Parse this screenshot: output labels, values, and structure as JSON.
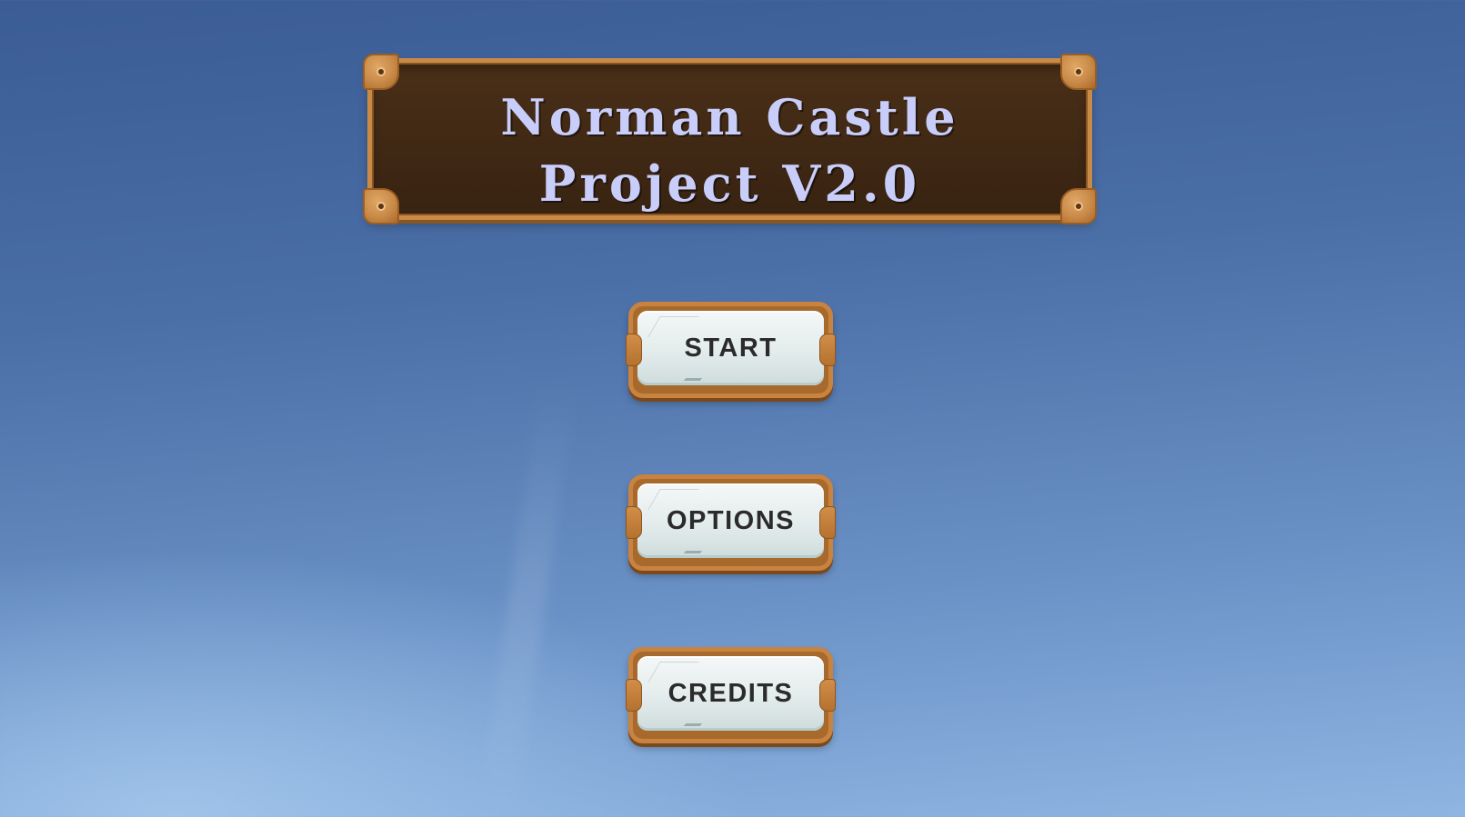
{
  "title": {
    "line1": "Norman Castle",
    "line2": "Project V2.0"
  },
  "menu": {
    "start_label": "START",
    "options_label": "OPTIONS",
    "credits_label": "CREDITS"
  },
  "colors": {
    "sky_top": "#3b5c94",
    "sky_bottom": "#8fb5e2",
    "banner_fill": "#3f2814",
    "frame_wood": "#c98a48",
    "title_text": "#c9cdfa",
    "button_face": "#e3ecec",
    "button_text": "#2b2b2b"
  }
}
